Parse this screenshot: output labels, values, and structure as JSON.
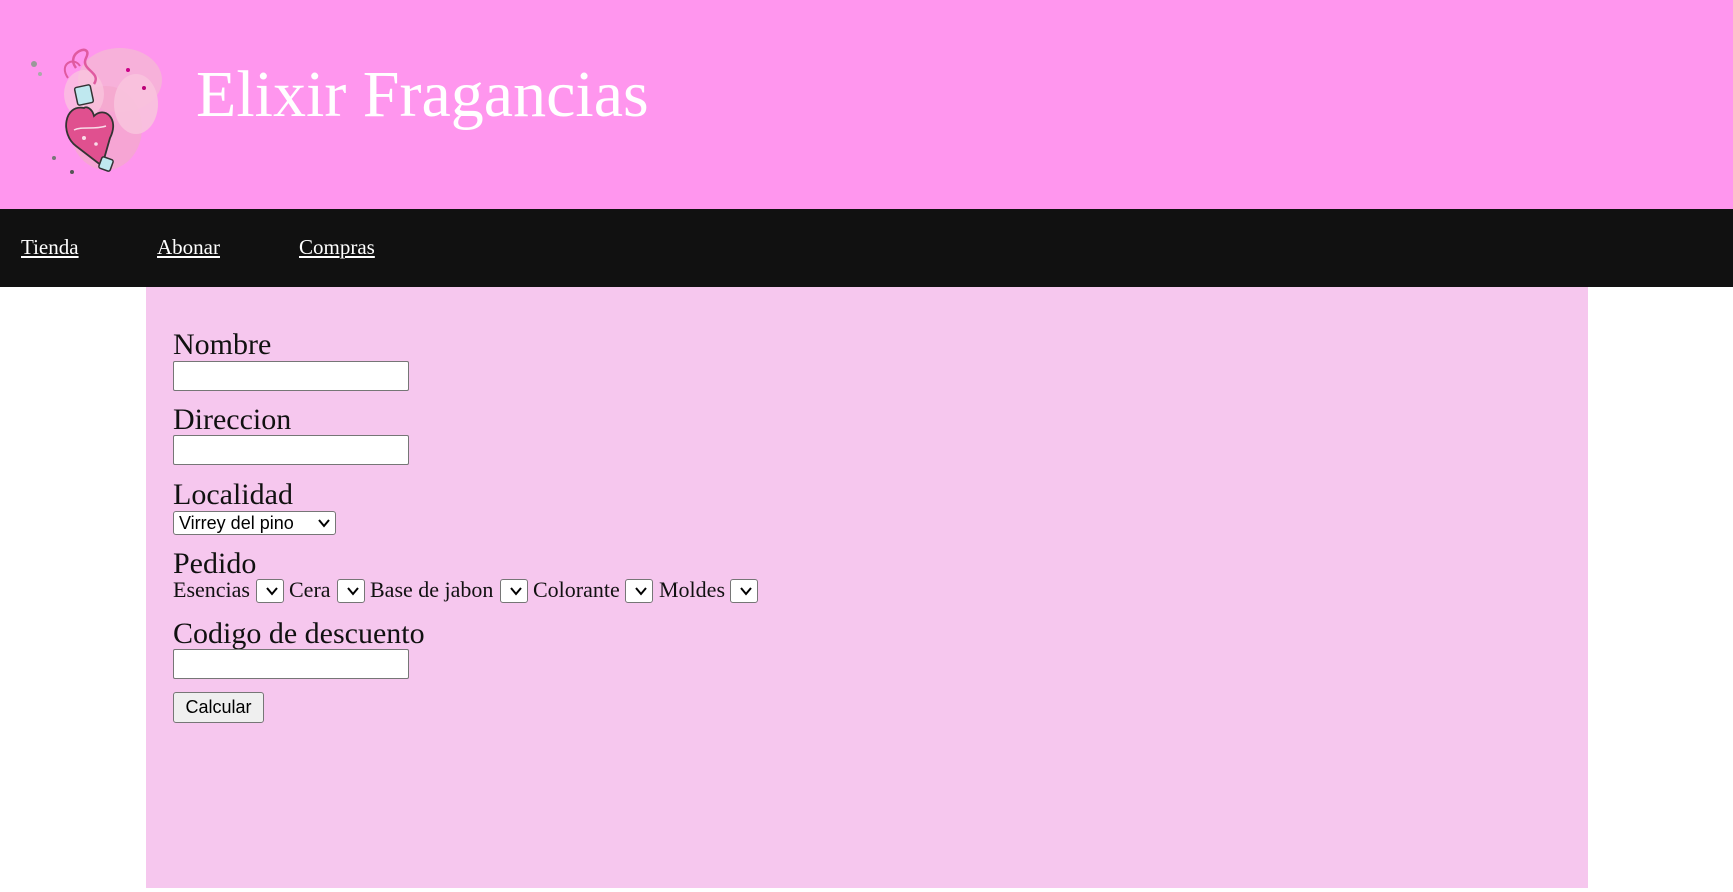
{
  "header": {
    "title": "Elixir Fragancias",
    "logo_icon": "potion-bottle-icon",
    "background": "#ff96ee"
  },
  "nav": {
    "items": [
      {
        "label": "Tienda"
      },
      {
        "label": "Abonar"
      },
      {
        "label": "Compras"
      }
    ],
    "background": "#111111"
  },
  "form": {
    "background": "#f6c7ee",
    "nombre": {
      "label": "Nombre",
      "value": ""
    },
    "direccion": {
      "label": "Direccion",
      "value": ""
    },
    "localidad": {
      "label": "Localidad",
      "selected": "Virrey del pino"
    },
    "pedido": {
      "label": "Pedido",
      "items": [
        {
          "label": "Esencias",
          "selected": ""
        },
        {
          "label": "Cera",
          "selected": ""
        },
        {
          "label": "Base de jabon",
          "selected": ""
        },
        {
          "label": "Colorante",
          "selected": ""
        },
        {
          "label": "Moldes",
          "selected": ""
        }
      ]
    },
    "codigo": {
      "label": "Codigo de descuento",
      "value": ""
    },
    "submit_label": "Calcular"
  }
}
